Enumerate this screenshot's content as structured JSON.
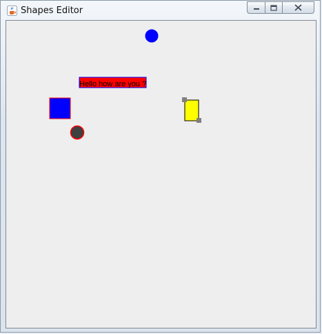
{
  "window": {
    "title": "Shapes Editor",
    "icon": "java-cup-icon",
    "controls": {
      "minimize_icon": "minimize-icon",
      "maximize_icon": "maximize-icon",
      "close_icon": "close-icon"
    }
  },
  "canvas": {
    "background_color": "#eeeeee",
    "shapes": [
      {
        "kind": "circle",
        "fill": "#0000ff",
        "stroke": "#0000ff"
      },
      {
        "kind": "text-box",
        "text": "Hello how are you ?",
        "fill": "#ff0000",
        "stroke": "#0000ff",
        "text_color": "#000000"
      },
      {
        "kind": "square",
        "fill": "#0000ff",
        "stroke": "#ff0000"
      },
      {
        "kind": "rectangle",
        "fill": "#ffff00",
        "stroke": "#000000",
        "selected": true
      },
      {
        "kind": "circle",
        "fill": "#404040",
        "stroke": "#ff0000"
      }
    ],
    "selection_handle_color": "#808080"
  }
}
